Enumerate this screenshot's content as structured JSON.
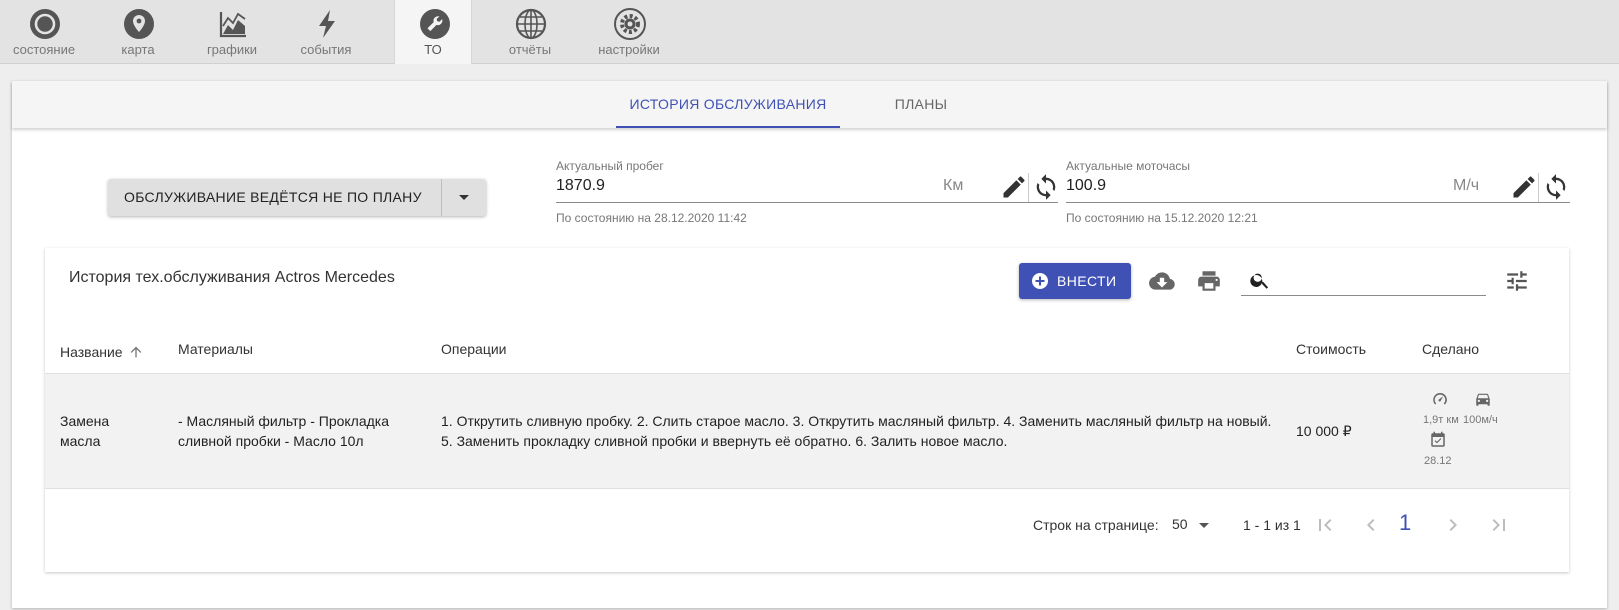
{
  "nav": [
    {
      "label": "состояние",
      "icon": "status-circle-icon",
      "active": false
    },
    {
      "label": "карта",
      "icon": "map-pin-icon",
      "active": false
    },
    {
      "label": "графики",
      "icon": "area-chart-icon",
      "active": false
    },
    {
      "label": "события",
      "icon": "lightning-icon",
      "active": false
    },
    {
      "label": "ТО",
      "icon": "wrench-icon",
      "active": true
    },
    {
      "label": "отчёты",
      "icon": "report-globe-icon",
      "active": false
    },
    {
      "label": "настройки",
      "icon": "gear-icon",
      "active": false
    }
  ],
  "tabs": [
    {
      "label": "ИСТОРИЯ ОБСЛУЖИВАНИЯ",
      "active": true
    },
    {
      "label": "ПЛАНЫ",
      "active": false
    }
  ],
  "plan_button": {
    "label": "ОБСЛУЖИВАНИЕ ВЕДЁТСЯ НЕ ПО ПЛАНУ"
  },
  "mileage": {
    "label": "Актуальный пробег",
    "value": "1870.9",
    "unit": "Км",
    "hint": "По состоянию на 28.12.2020 11:42"
  },
  "motohours": {
    "label": "Актуальные моточасы",
    "value": "100.9",
    "unit": "М/ч",
    "hint": "По состоянию на 15.12.2020 12:21"
  },
  "table": {
    "title": "История тех.обслуживания Actros Mercedes",
    "add_label": "ВНЕСТИ",
    "search_value": "",
    "columns": [
      "Название",
      "Материалы",
      "Операции",
      "Стоимость",
      "Сделано"
    ],
    "rows": [
      {
        "name_line1": "Замена",
        "name_line2": "масла",
        "materials_line1": "- Масляный фильтр - Прокладка",
        "materials_line2": "сливной пробки - Масло 10л",
        "operations_line1": "1. Открутить сливную пробку. 2. Слить старое масло. 3. Открутить масляный фильтр. 4. Заменить масляный фильтр на новый.",
        "operations_line2": "5. Заменить прокладку сливной пробки и ввернуть её обратно. 6. Залить новое масло.",
        "cost": "10 000 ₽",
        "done_mileage": "1,9т км",
        "done_hours": "100м/ч",
        "done_date": "28.12"
      }
    ]
  },
  "pagination": {
    "rows_per_page_label": "Строк на странице:",
    "rows_per_page": "50",
    "range": "1 - 1 из 1",
    "current_page": "1"
  },
  "colors": {
    "accent": "#3f51b5",
    "nav_bg": "#e3e3e3"
  }
}
